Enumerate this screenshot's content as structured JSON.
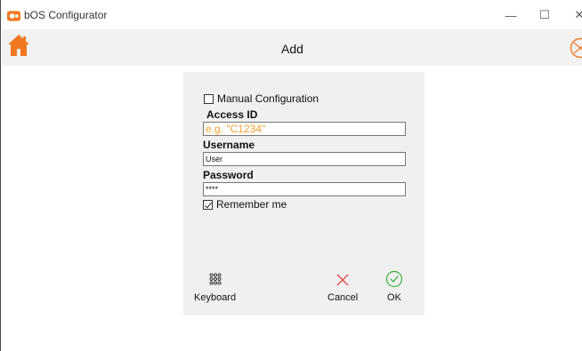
{
  "window": {
    "title": "bOS Configurator",
    "minimize_glyph": "—",
    "maximize_glyph": "☐",
    "close_glyph": "✕"
  },
  "header": {
    "title": "Add",
    "home_icon": "home-icon",
    "logo_icon": "bos-logo-icon",
    "accent_color": "#f07820"
  },
  "form": {
    "manual_config_label": "Manual Configuration",
    "manual_config_checked": false,
    "access_id_label": "Access ID",
    "access_id_placeholder": "e.g. \"C1234\"",
    "username_label": "Username",
    "username_value": "User",
    "password_label": "Password",
    "password_value": "****",
    "remember_label": "Remember me",
    "remember_checked": true
  },
  "actions": {
    "keyboard_label": "Keyboard",
    "cancel_label": "Cancel",
    "ok_label": "OK",
    "cancel_color": "#e05050",
    "ok_color": "#3cb040"
  }
}
